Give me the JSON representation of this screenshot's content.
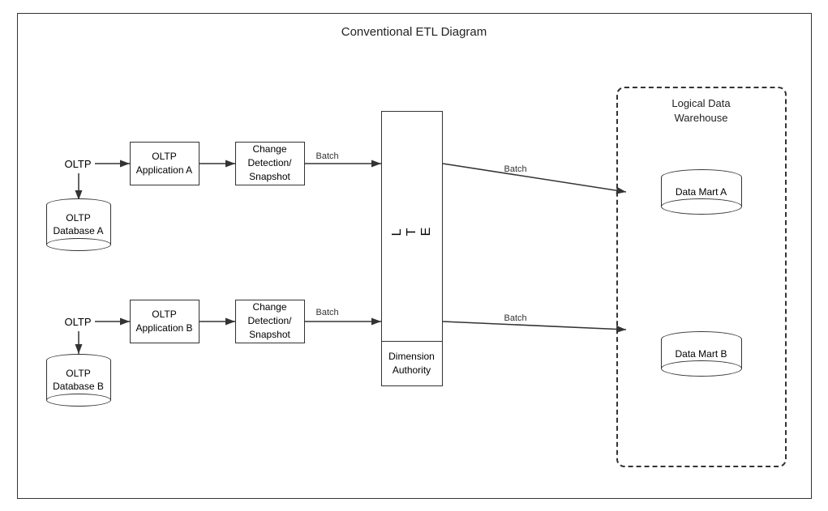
{
  "diagram": {
    "title": "Conventional ETL Diagram",
    "colors": {
      "border": "#333",
      "background": "#fff",
      "dashed": "#333"
    },
    "labels": {
      "oltp_a": "OLTP",
      "oltp_b": "OLTP",
      "oltp_app_a": "OLTP\nApplication A",
      "oltp_app_b": "OLTP\nApplication B",
      "change_detect_a": "Change\nDetection/\nSnapshot",
      "change_detect_b": "Change\nDetection/\nSnapshot",
      "etl": "E\nT\nL",
      "dimension_authority": "Dimension\nAuthority",
      "oltp_db_a": "OLTP\nDatabase A",
      "oltp_db_b": "OLTP\nDatabase B",
      "data_mart_a": "Data Mart A",
      "data_mart_b": "Data Mart B",
      "logical_dw": "Logical Data\nWarehouse",
      "batch1": "Batch",
      "batch2": "Batch",
      "batch3": "Batch",
      "batch4": "Batch"
    }
  }
}
